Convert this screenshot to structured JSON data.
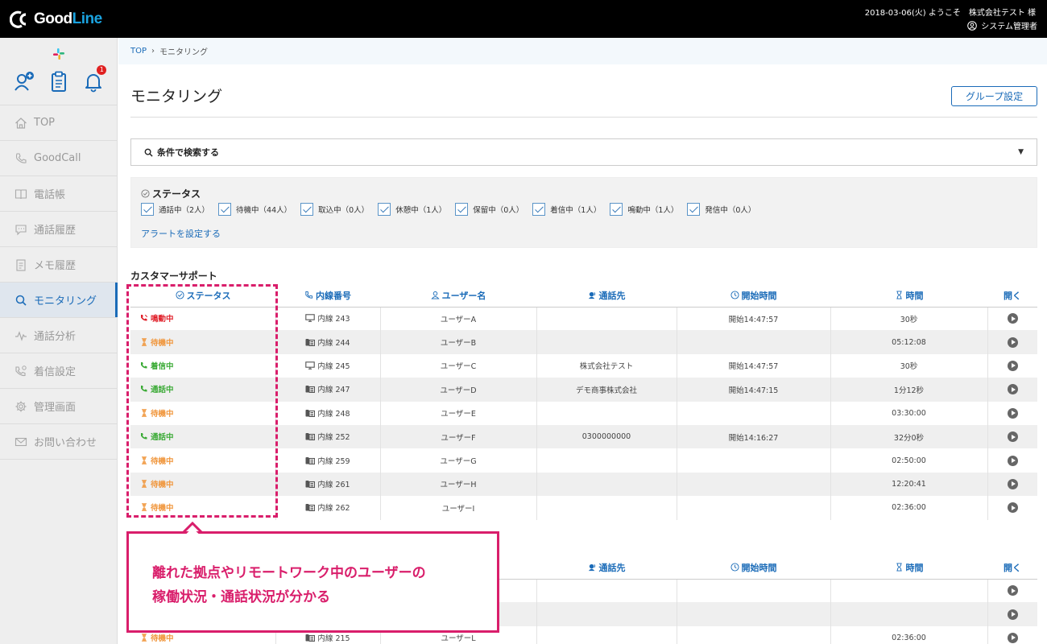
{
  "header": {
    "logo_text_a": "Good",
    "logo_text_b": "Line",
    "line1": "2018-03-06(火) ようこそ　株式会社テスト 様",
    "line2": "システム管理者"
  },
  "sidebar": {
    "bell_badge": "1",
    "items": [
      {
        "label": "TOP",
        "icon": "home-icon"
      },
      {
        "label": "GoodCall",
        "icon": "phone-icon"
      },
      {
        "label": "電話帳",
        "icon": "book-icon"
      },
      {
        "label": "通話履歴",
        "icon": "chat-icon"
      },
      {
        "label": "メモ履歴",
        "icon": "memo-icon"
      },
      {
        "label": "モニタリング",
        "icon": "search-icon"
      },
      {
        "label": "通話分析",
        "icon": "pulse-icon"
      },
      {
        "label": "着信設定",
        "icon": "incoming-icon"
      },
      {
        "label": "管理画面",
        "icon": "gear-icon"
      },
      {
        "label": "お問い合わせ",
        "icon": "mail-icon"
      }
    ]
  },
  "breadcrumb": {
    "home": "TOP",
    "sep": "›",
    "current": "モニタリング"
  },
  "page": {
    "title": "モニタリング",
    "group_button": "グループ設定"
  },
  "search": {
    "label": "条件で検索する",
    "caret": "▼"
  },
  "status_filter": {
    "title": "ステータス",
    "checks": [
      "通話中（2人）",
      "待機中（44人）",
      "取込中（0人）",
      "休憩中（1人）",
      "保留中（0人）",
      "着信中（1人）",
      "鳴動中（1人）",
      "発信中（0人）"
    ],
    "alert_link": "アラートを設定する"
  },
  "group1": {
    "name": "カスタマーサポート",
    "columns": [
      "ステータス",
      "内線番号",
      "ユーザー名",
      "通話先",
      "開始時間",
      "時間",
      "開く"
    ],
    "rows": [
      {
        "status": "鳴動中",
        "kind": "ringing",
        "ext": "内線 243",
        "device": "pc",
        "user": "ユーザーA",
        "peer": "",
        "start": "開始14:47:57",
        "time": "30秒"
      },
      {
        "status": "待機中",
        "kind": "waiting",
        "ext": "内線 244",
        "device": "phone",
        "user": "ユーザーB",
        "peer": "",
        "start": "",
        "time": "05:12:08"
      },
      {
        "status": "着信中",
        "kind": "talking",
        "ext": "内線 245",
        "device": "pc",
        "user": "ユーザーC",
        "peer": "株式会社テスト",
        "start": "開始14:47:57",
        "time": "30秒"
      },
      {
        "status": "通話中",
        "kind": "talking",
        "ext": "内線 247",
        "device": "phone",
        "user": "ユーザーD",
        "peer": "デモ商事株式会社",
        "start": "開始14:47:15",
        "time": "1分12秒"
      },
      {
        "status": "待機中",
        "kind": "waiting",
        "ext": "内線 248",
        "device": "phone",
        "user": "ユーザーE",
        "peer": "",
        "start": "",
        "time": "03:30:00"
      },
      {
        "status": "通話中",
        "kind": "talking",
        "ext": "内線 252",
        "device": "phone",
        "user": "ユーザーF",
        "peer": "0300000000",
        "start": "開始14:16:27",
        "time": "32分0秒"
      },
      {
        "status": "待機中",
        "kind": "waiting",
        "ext": "内線 259",
        "device": "phone",
        "user": "ユーザーG",
        "peer": "",
        "start": "",
        "time": "02:50:00"
      },
      {
        "status": "待機中",
        "kind": "waiting",
        "ext": "内線 261",
        "device": "phone",
        "user": "ユーザーH",
        "peer": "",
        "start": "",
        "time": "12:20:41"
      },
      {
        "status": "待機中",
        "kind": "waiting",
        "ext": "内線 262",
        "device": "phone",
        "user": "ユーザーI",
        "peer": "",
        "start": "",
        "time": "02:36:00"
      }
    ]
  },
  "group2": {
    "columns": [
      "通話先",
      "開始時間",
      "時間",
      "開く"
    ],
    "rows": [
      {
        "status": "",
        "kind": "",
        "ext": "",
        "device": "",
        "user": "",
        "peer": "",
        "start": "",
        "time": ""
      },
      {
        "status": "",
        "kind": "",
        "ext": "",
        "device": "",
        "user": "",
        "peer": "",
        "start": "",
        "time": ""
      },
      {
        "status": "待機中",
        "kind": "waiting",
        "ext": "内線 215",
        "device": "phone",
        "user": "ユーザーL",
        "peer": "",
        "start": "",
        "time": "02:36:00"
      }
    ]
  },
  "callout": {
    "line1": "離れた拠点やリモートワーク中のユーザーの",
    "line2": "稼働状況・通話状況が分かる"
  },
  "colors": {
    "accent": "#1a6bb8",
    "ringing": "#e0202a",
    "waiting": "#f0963c",
    "talking": "#3aaa35",
    "highlight": "#d91e6b"
  }
}
